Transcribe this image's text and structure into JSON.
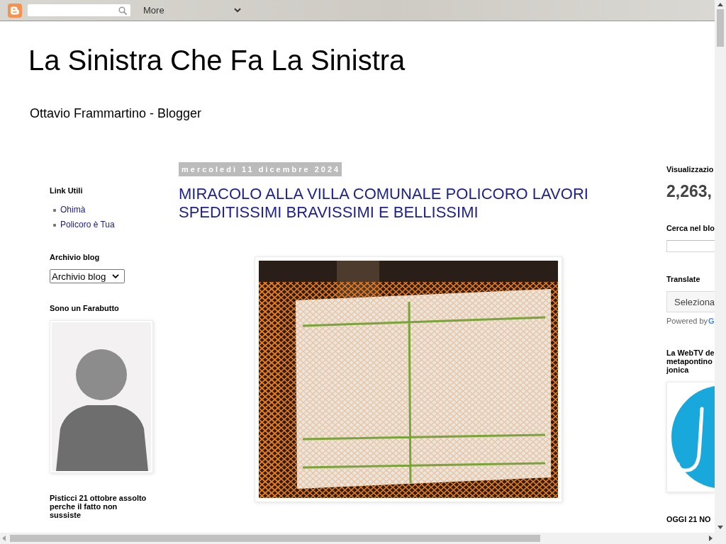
{
  "navbar": {
    "more_label": "More"
  },
  "header": {
    "title": "La Sinistra Che Fa La Sinistra",
    "description": "Ottavio Frammartino - Blogger"
  },
  "left_sidebar": {
    "widgets": [
      {
        "kind": "links",
        "title": "Link Utili",
        "items": [
          {
            "label": "Ohimà"
          },
          {
            "label": "Policoro è Tua"
          }
        ]
      },
      {
        "kind": "dropdown",
        "title": "Archivio blog",
        "value": "Archivio blog"
      },
      {
        "kind": "photo",
        "title": "Sono un Farabutto"
      },
      {
        "kind": "heading",
        "title": "Pisticci 21 ottobre assolto perche il fatto non sussiste"
      }
    ]
  },
  "post": {
    "date": "mercoledì 11 dicembre 2024",
    "title": "MIRACOLO ALLA VILLA COMUNALE POLICORO LAVORI SPEDITISSIMI BRAVISSIMI E BELLISSIMI"
  },
  "right_sidebar": {
    "widgets": [
      {
        "kind": "stats",
        "title": "Visualizzazio",
        "value": "2,263,"
      },
      {
        "kind": "search",
        "title": "Cerca nel blo"
      },
      {
        "kind": "translate",
        "title": "Translate",
        "value": "Seleziona",
        "powered_by": "Powered by",
        "logo_text": "G"
      },
      {
        "kind": "logo",
        "title_lines": [
          "La WebTV de",
          "metapontino",
          "jonica"
        ]
      },
      {
        "kind": "heading",
        "title": "OGGI 21 NO"
      }
    ]
  }
}
